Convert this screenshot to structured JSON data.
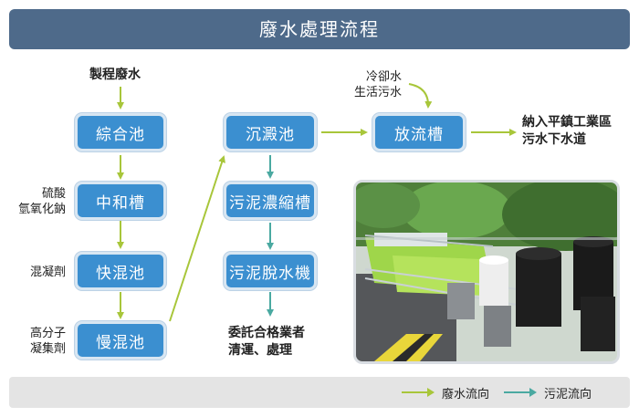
{
  "title": "廢水處理流程",
  "source": "製程廢水",
  "boxes": {
    "zonghe": "綜合池",
    "zhonghe": "中和槽",
    "kuaihun": "快混池",
    "manhun": "慢混池",
    "chendian": "沉澱池",
    "nongsuo": "污泥濃縮槽",
    "tuoshui": "污泥脫水機",
    "fangliu": "放流槽"
  },
  "chemicals": {
    "zhonghe": [
      "硫酸",
      "氫氧化鈉"
    ],
    "kuaihun": [
      "混凝劑"
    ],
    "manhun": [
      "高分子",
      "凝集劑"
    ]
  },
  "side_inputs": [
    "冷卻水",
    "生活污水"
  ],
  "discharge": [
    "納入平鎮工業區",
    "污水下水道"
  ],
  "sludge_out": [
    "委託合格業者",
    "清運、處理"
  ],
  "legend": {
    "wastewater": "廢水流向",
    "sludge": "污泥流向"
  },
  "colors": {
    "wastewater": "#a8c63a",
    "sludge": "#4aa9a1",
    "box": "#3b8fd0",
    "title_bar": "#4e6a8a"
  }
}
